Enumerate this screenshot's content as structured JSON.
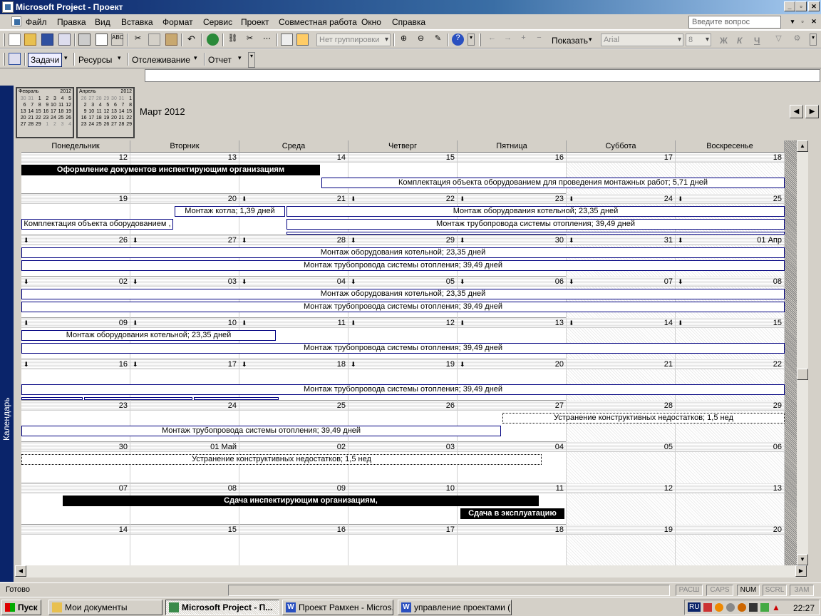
{
  "window": {
    "title": "Microsoft Project - Проект"
  },
  "menu": {
    "items": [
      "Файл",
      "Правка",
      "Вид",
      "Вставка",
      "Формат",
      "Сервис",
      "Проект",
      "Совместная работа",
      "Окно",
      "Справка"
    ],
    "ask_placeholder": "Введите вопрос"
  },
  "toolbar": {
    "grouping": "Нет группировки",
    "show": "Показать",
    "font": "Arial",
    "size": "8",
    "bold": "Ж",
    "italic": "К",
    "underline": "Ч"
  },
  "guide": {
    "tasks": "Задачи",
    "resources": "Ресурсы",
    "tracking": "Отслеживание",
    "report": "Отчет"
  },
  "minicals": [
    {
      "month": "Февраль",
      "year": "2012",
      "days": [
        "30",
        "31",
        "1",
        "2",
        "3",
        "4",
        "5",
        "6",
        "7",
        "8",
        "9",
        "10",
        "11",
        "12",
        "13",
        "14",
        "15",
        "16",
        "17",
        "18",
        "19",
        "20",
        "21",
        "22",
        "23",
        "24",
        "25",
        "26",
        "27",
        "28",
        "29",
        "1",
        "2",
        "3",
        "4"
      ],
      "dim": [
        0,
        1,
        31,
        32,
        33,
        34
      ]
    },
    {
      "month": "Апрель",
      "year": "2012",
      "days": [
        "26",
        "27",
        "28",
        "29",
        "30",
        "31",
        "1",
        "2",
        "3",
        "4",
        "5",
        "6",
        "7",
        "8",
        "9",
        "10",
        "11",
        "12",
        "13",
        "14",
        "15",
        "16",
        "17",
        "18",
        "19",
        "20",
        "21",
        "22",
        "23",
        "24",
        "25",
        "26",
        "27",
        "28",
        "29"
      ],
      "dim": [
        0,
        1,
        2,
        3,
        4,
        5
      ]
    }
  ],
  "calendar": {
    "month_title": "Март 2012",
    "weekdays": [
      "Понедельник",
      "Вторник",
      "Среда",
      "Четверг",
      "Пятница",
      "Суббота",
      "Воскресенье"
    ],
    "weeks": [
      {
        "days": [
          "12",
          "13",
          "14",
          "15",
          "16",
          "17",
          "18"
        ],
        "arrows": [
          false,
          false,
          false,
          false,
          false,
          false,
          false
        ]
      },
      {
        "days": [
          "19",
          "20",
          "21",
          "22",
          "23",
          "24",
          "25"
        ],
        "arrows": [
          false,
          false,
          true,
          true,
          true,
          true,
          true
        ]
      },
      {
        "days": [
          "26",
          "27",
          "28",
          "29",
          "30",
          "31",
          "01 Апр"
        ],
        "arrows": [
          true,
          true,
          true,
          true,
          true,
          true,
          true
        ]
      },
      {
        "days": [
          "02",
          "03",
          "04",
          "05",
          "06",
          "07",
          "08"
        ],
        "arrows": [
          true,
          true,
          true,
          true,
          true,
          true,
          true
        ]
      },
      {
        "days": [
          "09",
          "10",
          "11",
          "12",
          "13",
          "14",
          "15"
        ],
        "arrows": [
          true,
          true,
          true,
          true,
          true,
          true,
          true
        ]
      },
      {
        "days": [
          "16",
          "17",
          "18",
          "19",
          "20",
          "21",
          "22"
        ],
        "arrows": [
          true,
          true,
          true,
          true,
          true,
          false,
          false
        ]
      },
      {
        "days": [
          "23",
          "24",
          "25",
          "26",
          "27",
          "28",
          "29"
        ],
        "arrows": [
          false,
          false,
          false,
          false,
          false,
          false,
          false
        ]
      },
      {
        "days": [
          "30",
          "01 Май",
          "02",
          "03",
          "04",
          "05",
          "06"
        ],
        "arrows": [
          false,
          false,
          false,
          false,
          false,
          false,
          false
        ]
      },
      {
        "days": [
          "07",
          "08",
          "09",
          "10",
          "11",
          "12",
          "13"
        ],
        "arrows": [
          false,
          false,
          false,
          false,
          false,
          false,
          false
        ]
      },
      {
        "days": [
          "14",
          "15",
          "16",
          "17",
          "18",
          "19",
          "20"
        ],
        "arrows": [
          false,
          false,
          false,
          false,
          false,
          false,
          false
        ]
      }
    ],
    "tasks": {
      "docs": "Оформление документов инспектирующим организациям",
      "equip_full": "Комплектация объекта оборудованием для проведения монтажных работ; 5,71 дней",
      "equip_short": "Комплектация объекта оборудованием ,",
      "boiler": "Монтаж котла; 1,39 дней",
      "boiler_room": "Монтаж оборудования котельной; 23,35 дней",
      "pipes": "Монтаж трубопровода системы отопления; 39,49 дней",
      "defects": "Устранение конструктивных недостатков; 1,5 нед",
      "handover_insp": "Сдача инспектирующим организациям,",
      "handover_op": "Сдача в эксплуатацию"
    }
  },
  "viewbar": {
    "label": "Календарь"
  },
  "status": {
    "text": "Готово",
    "indicators": [
      "РАСШ",
      "CAPS",
      "NUM",
      "SCRL",
      "ЗАМ"
    ]
  },
  "taskbar": {
    "start": "Пуск",
    "buttons": [
      "Мои документы",
      "Microsoft Project - П...",
      "Проект Рамхен - Micros...",
      "управление проектами (..."
    ],
    "lang": "RU",
    "clock": "22:27"
  }
}
